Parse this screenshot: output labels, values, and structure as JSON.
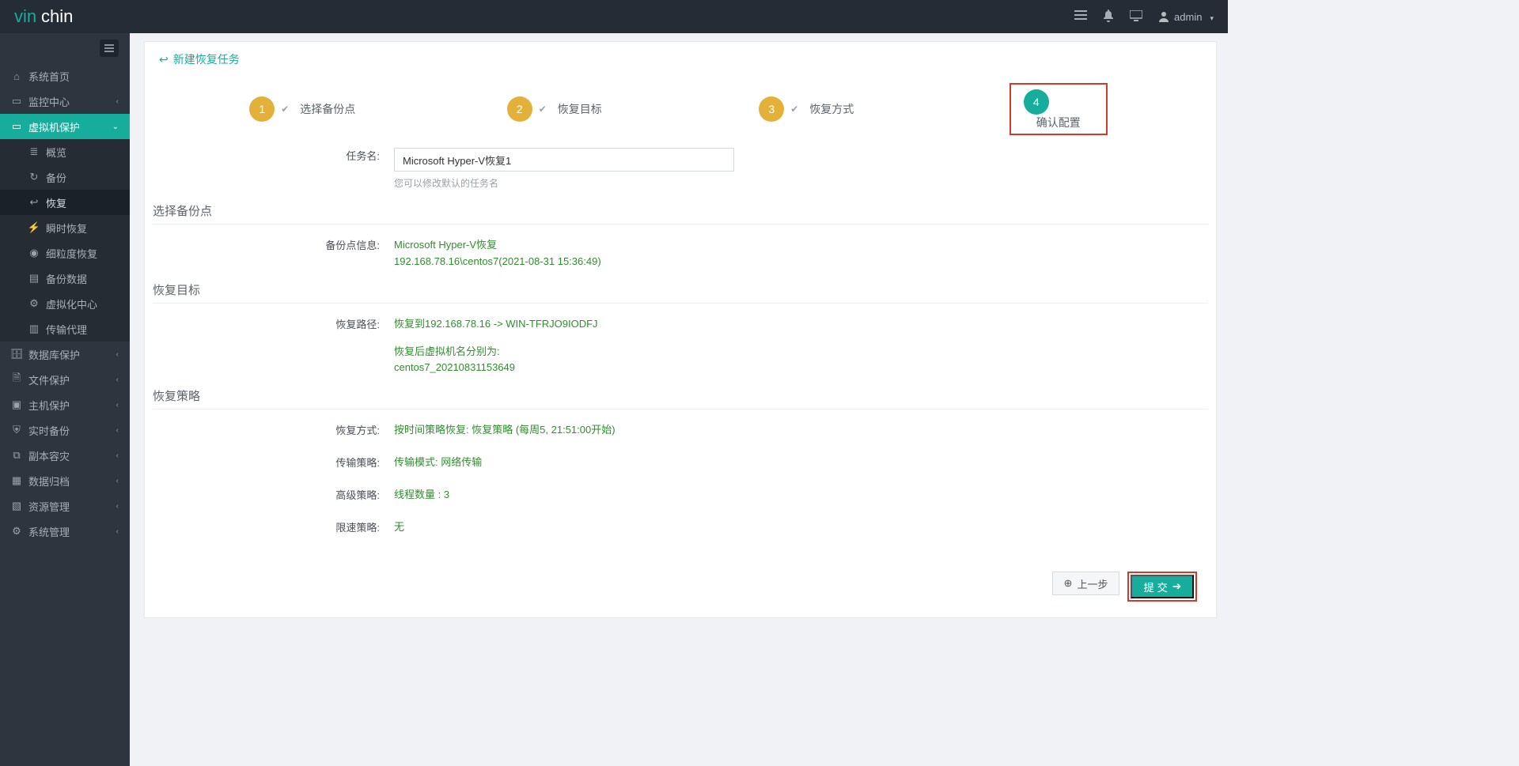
{
  "brand": {
    "part1": "vin",
    "part2": "chin"
  },
  "topbar": {
    "user": "admin"
  },
  "sidebar": {
    "items": [
      {
        "label": "系统首页"
      },
      {
        "label": "监控中心"
      },
      {
        "label": "虚拟机保护"
      },
      {
        "label": "数据库保护"
      },
      {
        "label": "文件保护"
      },
      {
        "label": "主机保护"
      },
      {
        "label": "实时备份"
      },
      {
        "label": "副本容灾"
      },
      {
        "label": "数据归档"
      },
      {
        "label": "资源管理"
      },
      {
        "label": "系统管理"
      }
    ],
    "sub": [
      {
        "label": "概览"
      },
      {
        "label": "备份"
      },
      {
        "label": "恢复"
      },
      {
        "label": "瞬时恢复"
      },
      {
        "label": "细粒度恢复"
      },
      {
        "label": "备份数据"
      },
      {
        "label": "虚拟化中心"
      },
      {
        "label": "传输代理"
      }
    ]
  },
  "panel": {
    "title": "新建恢复任务"
  },
  "steps": {
    "s1": "选择备份点",
    "s2": "恢复目标",
    "s3": "恢复方式",
    "s4": "确认配置"
  },
  "form": {
    "taskname_label": "任务名:",
    "taskname_value": "Microsoft Hyper-V恢复1",
    "taskname_hint": "您可以修改默认的任务名",
    "section_backup": "选择备份点",
    "backup_info_label": "备份点信息:",
    "backup_info_line1": "Microsoft Hyper-V恢复",
    "backup_info_line2": "192.168.78.16\\centos7(2021-08-31 15:36:49)",
    "section_target": "恢复目标",
    "restore_path_label": "恢复路径:",
    "restore_path_value": "恢复到192.168.78.16 -> WIN-TFRJO9IODFJ",
    "restore_vm_label": "恢复后虚拟机名分别为:",
    "restore_vm_value": "centos7_20210831153649",
    "section_policy": "恢复策略",
    "mode_label": "恢复方式:",
    "mode_value": "按时间策略恢复: 恢复策略 (每周5, 21:51:00开始)",
    "trans_label": "传输策略:",
    "trans_value": "传输模式: 网络传输",
    "adv_label": "高级策略:",
    "adv_value": "线程数量 : 3",
    "limit_label": "限速策略:",
    "limit_value": "无"
  },
  "buttons": {
    "prev": "上一步",
    "submit": "提 交"
  }
}
